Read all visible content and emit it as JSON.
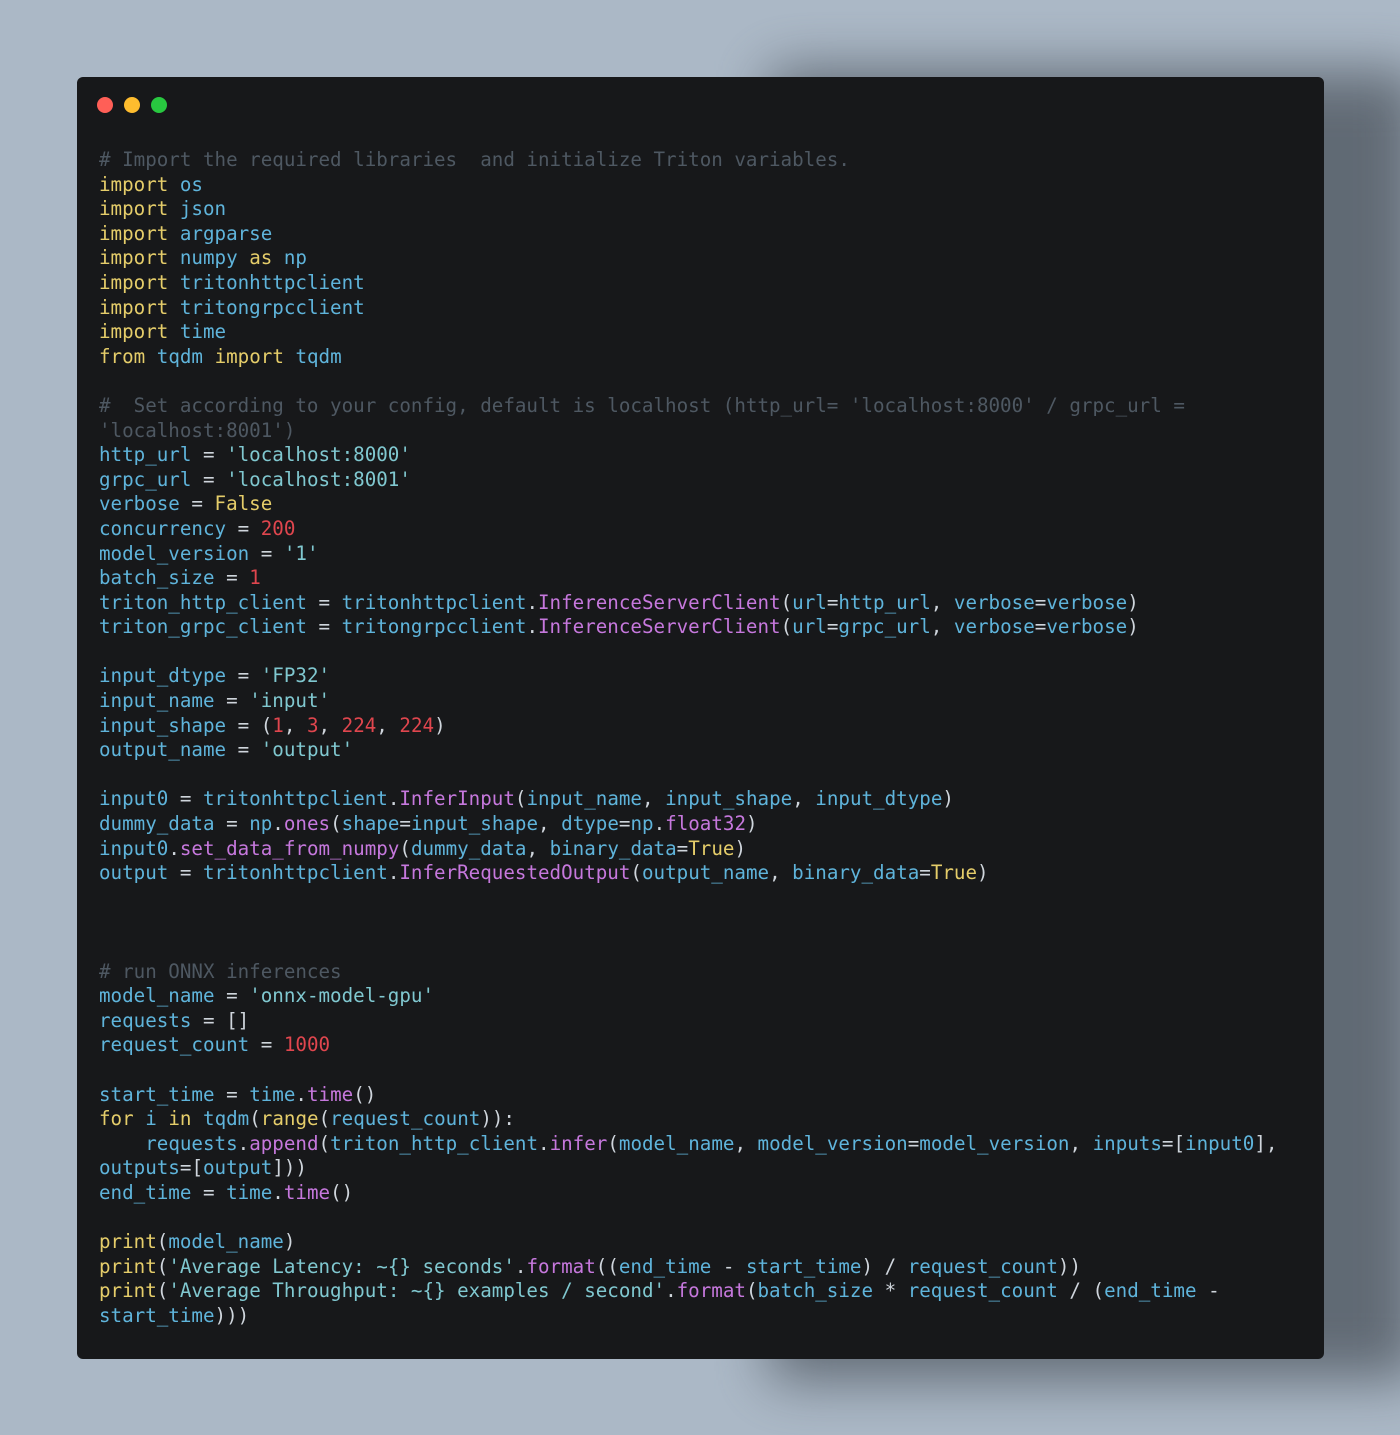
{
  "colors": {
    "background": "#abb8c6",
    "editor_background": "#17181a",
    "close_dot": "#ff5f57",
    "minimize_dot": "#febc2e",
    "maximize_dot": "#28c840",
    "comment": "#4e5862",
    "keyword": "#e5cd6a",
    "identifier": "#5fb4db",
    "string": "#80c8d0",
    "number": "#e0464e",
    "function": "#c678dd",
    "plain": "#cfd5dc"
  },
  "window": {
    "controls": [
      "close",
      "minimize",
      "maximize"
    ]
  },
  "code": {
    "language": "python",
    "lines": [
      [
        [
          "comment",
          "# Import the required libraries  and initialize Triton variables."
        ]
      ],
      [
        [
          "kw",
          "import"
        ],
        [
          "op",
          " "
        ],
        [
          "mod",
          "os"
        ]
      ],
      [
        [
          "kw",
          "import"
        ],
        [
          "op",
          " "
        ],
        [
          "mod",
          "json"
        ]
      ],
      [
        [
          "kw",
          "import"
        ],
        [
          "op",
          " "
        ],
        [
          "mod",
          "argparse"
        ]
      ],
      [
        [
          "kw",
          "import"
        ],
        [
          "op",
          " "
        ],
        [
          "mod",
          "numpy"
        ],
        [
          "op",
          " "
        ],
        [
          "kw",
          "as"
        ],
        [
          "op",
          " "
        ],
        [
          "mod",
          "np"
        ]
      ],
      [
        [
          "kw",
          "import"
        ],
        [
          "op",
          " "
        ],
        [
          "mod",
          "tritonhttpclient"
        ]
      ],
      [
        [
          "kw",
          "import"
        ],
        [
          "op",
          " "
        ],
        [
          "mod",
          "tritongrpcclient"
        ]
      ],
      [
        [
          "kw",
          "import"
        ],
        [
          "op",
          " "
        ],
        [
          "mod",
          "time"
        ]
      ],
      [
        [
          "kw",
          "from"
        ],
        [
          "op",
          " "
        ],
        [
          "mod",
          "tqdm"
        ],
        [
          "op",
          " "
        ],
        [
          "kw",
          "import"
        ],
        [
          "op",
          " "
        ],
        [
          "mod",
          "tqdm"
        ]
      ],
      [],
      [
        [
          "comment",
          "#  Set according to your config, default is localhost (http_url= 'localhost:8000' / grpc_url ="
        ]
      ],
      [
        [
          "comment",
          "'localhost:8001')"
        ]
      ],
      [
        [
          "var",
          "http_url"
        ],
        [
          "op",
          " = "
        ],
        [
          "str",
          "'localhost:8000'"
        ]
      ],
      [
        [
          "var",
          "grpc_url"
        ],
        [
          "op",
          " = "
        ],
        [
          "str",
          "'localhost:8001'"
        ]
      ],
      [
        [
          "var",
          "verbose"
        ],
        [
          "op",
          " = "
        ],
        [
          "const",
          "False"
        ]
      ],
      [
        [
          "var",
          "concurrency"
        ],
        [
          "op",
          " = "
        ],
        [
          "num",
          "200"
        ]
      ],
      [
        [
          "var",
          "model_version"
        ],
        [
          "op",
          " = "
        ],
        [
          "str",
          "'1'"
        ]
      ],
      [
        [
          "var",
          "batch_size"
        ],
        [
          "op",
          " = "
        ],
        [
          "num",
          "1"
        ]
      ],
      [
        [
          "var",
          "triton_http_client"
        ],
        [
          "op",
          " = "
        ],
        [
          "mod",
          "tritonhttpclient"
        ],
        [
          "punc",
          "."
        ],
        [
          "fn",
          "InferenceServerClient"
        ],
        [
          "punc",
          "("
        ],
        [
          "var",
          "url"
        ],
        [
          "op",
          "="
        ],
        [
          "var",
          "http_url"
        ],
        [
          "punc",
          ", "
        ],
        [
          "var",
          "verbose"
        ],
        [
          "op",
          "="
        ],
        [
          "var",
          "verbose"
        ],
        [
          "punc",
          ")"
        ]
      ],
      [
        [
          "var",
          "triton_grpc_client"
        ],
        [
          "op",
          " = "
        ],
        [
          "mod",
          "tritongrpcclient"
        ],
        [
          "punc",
          "."
        ],
        [
          "fn",
          "InferenceServerClient"
        ],
        [
          "punc",
          "("
        ],
        [
          "var",
          "url"
        ],
        [
          "op",
          "="
        ],
        [
          "var",
          "grpc_url"
        ],
        [
          "punc",
          ", "
        ],
        [
          "var",
          "verbose"
        ],
        [
          "op",
          "="
        ],
        [
          "var",
          "verbose"
        ],
        [
          "punc",
          ")"
        ]
      ],
      [],
      [
        [
          "var",
          "input_dtype"
        ],
        [
          "op",
          " = "
        ],
        [
          "str",
          "'FP32'"
        ]
      ],
      [
        [
          "var",
          "input_name"
        ],
        [
          "op",
          " = "
        ],
        [
          "str",
          "'input'"
        ]
      ],
      [
        [
          "var",
          "input_shape"
        ],
        [
          "op",
          " = "
        ],
        [
          "punc",
          "("
        ],
        [
          "num",
          "1"
        ],
        [
          "punc",
          ", "
        ],
        [
          "num",
          "3"
        ],
        [
          "punc",
          ", "
        ],
        [
          "num",
          "224"
        ],
        [
          "punc",
          ", "
        ],
        [
          "num",
          "224"
        ],
        [
          "punc",
          ")"
        ]
      ],
      [
        [
          "var",
          "output_name"
        ],
        [
          "op",
          " = "
        ],
        [
          "str",
          "'output'"
        ]
      ],
      [],
      [
        [
          "var",
          "input0"
        ],
        [
          "op",
          " = "
        ],
        [
          "mod",
          "tritonhttpclient"
        ],
        [
          "punc",
          "."
        ],
        [
          "fn",
          "InferInput"
        ],
        [
          "punc",
          "("
        ],
        [
          "var",
          "input_name"
        ],
        [
          "punc",
          ", "
        ],
        [
          "var",
          "input_shape"
        ],
        [
          "punc",
          ", "
        ],
        [
          "var",
          "input_dtype"
        ],
        [
          "punc",
          ")"
        ]
      ],
      [
        [
          "var",
          "dummy_data"
        ],
        [
          "op",
          " = "
        ],
        [
          "mod",
          "np"
        ],
        [
          "punc",
          "."
        ],
        [
          "fn",
          "ones"
        ],
        [
          "punc",
          "("
        ],
        [
          "var",
          "shape"
        ],
        [
          "op",
          "="
        ],
        [
          "var",
          "input_shape"
        ],
        [
          "punc",
          ", "
        ],
        [
          "var",
          "dtype"
        ],
        [
          "op",
          "="
        ],
        [
          "mod",
          "np"
        ],
        [
          "punc",
          "."
        ],
        [
          "fn",
          "float32"
        ],
        [
          "punc",
          ")"
        ]
      ],
      [
        [
          "var",
          "input0"
        ],
        [
          "punc",
          "."
        ],
        [
          "fn",
          "set_data_from_numpy"
        ],
        [
          "punc",
          "("
        ],
        [
          "var",
          "dummy_data"
        ],
        [
          "punc",
          ", "
        ],
        [
          "var",
          "binary_data"
        ],
        [
          "op",
          "="
        ],
        [
          "const",
          "True"
        ],
        [
          "punc",
          ")"
        ]
      ],
      [
        [
          "var",
          "output"
        ],
        [
          "op",
          " = "
        ],
        [
          "mod",
          "tritonhttpclient"
        ],
        [
          "punc",
          "."
        ],
        [
          "fn",
          "InferRequestedOutput"
        ],
        [
          "punc",
          "("
        ],
        [
          "var",
          "output_name"
        ],
        [
          "punc",
          ", "
        ],
        [
          "var",
          "binary_data"
        ],
        [
          "op",
          "="
        ],
        [
          "const",
          "True"
        ],
        [
          "punc",
          ")"
        ]
      ],
      [],
      [],
      [],
      [
        [
          "comment",
          "# run ONNX inferences"
        ]
      ],
      [
        [
          "var",
          "model_name"
        ],
        [
          "op",
          " = "
        ],
        [
          "str",
          "'onnx-model-gpu'"
        ]
      ],
      [
        [
          "var",
          "requests"
        ],
        [
          "op",
          " = "
        ],
        [
          "punc",
          "[]"
        ]
      ],
      [
        [
          "var",
          "request_count"
        ],
        [
          "op",
          " = "
        ],
        [
          "num",
          "1000"
        ]
      ],
      [],
      [
        [
          "var",
          "start_time"
        ],
        [
          "op",
          " = "
        ],
        [
          "mod",
          "time"
        ],
        [
          "punc",
          "."
        ],
        [
          "fn",
          "time"
        ],
        [
          "punc",
          "()"
        ]
      ],
      [
        [
          "kw",
          "for"
        ],
        [
          "op",
          " "
        ],
        [
          "var",
          "i"
        ],
        [
          "op",
          " "
        ],
        [
          "kw",
          "in"
        ],
        [
          "op",
          " "
        ],
        [
          "var",
          "tqdm"
        ],
        [
          "punc",
          "("
        ],
        [
          "builtin",
          "range"
        ],
        [
          "punc",
          "("
        ],
        [
          "var",
          "request_count"
        ],
        [
          "punc",
          ")):"
        ]
      ],
      [
        [
          "op",
          "    "
        ],
        [
          "var",
          "requests"
        ],
        [
          "punc",
          "."
        ],
        [
          "fn",
          "append"
        ],
        [
          "punc",
          "("
        ],
        [
          "var",
          "triton_http_client"
        ],
        [
          "punc",
          "."
        ],
        [
          "fn",
          "infer"
        ],
        [
          "punc",
          "("
        ],
        [
          "var",
          "model_name"
        ],
        [
          "punc",
          ", "
        ],
        [
          "var",
          "model_version"
        ],
        [
          "op",
          "="
        ],
        [
          "var",
          "model_version"
        ],
        [
          "punc",
          ", "
        ],
        [
          "var",
          "inputs"
        ],
        [
          "op",
          "="
        ],
        [
          "punc",
          "["
        ],
        [
          "var",
          "input0"
        ],
        [
          "punc",
          "],"
        ]
      ],
      [
        [
          "var",
          "outputs"
        ],
        [
          "op",
          "="
        ],
        [
          "punc",
          "["
        ],
        [
          "var",
          "output"
        ],
        [
          "punc",
          "]))"
        ]
      ],
      [
        [
          "var",
          "end_time"
        ],
        [
          "op",
          " = "
        ],
        [
          "mod",
          "time"
        ],
        [
          "punc",
          "."
        ],
        [
          "fn",
          "time"
        ],
        [
          "punc",
          "()"
        ]
      ],
      [],
      [
        [
          "builtin",
          "print"
        ],
        [
          "punc",
          "("
        ],
        [
          "var",
          "model_name"
        ],
        [
          "punc",
          ")"
        ]
      ],
      [
        [
          "builtin",
          "print"
        ],
        [
          "punc",
          "("
        ],
        [
          "str",
          "'Average Latency: ~{} seconds'"
        ],
        [
          "punc",
          "."
        ],
        [
          "fn",
          "format"
        ],
        [
          "punc",
          "(("
        ],
        [
          "var",
          "end_time"
        ],
        [
          "op",
          " - "
        ],
        [
          "var",
          "start_time"
        ],
        [
          "punc",
          ") "
        ],
        [
          "op",
          "/ "
        ],
        [
          "var",
          "request_count"
        ],
        [
          "punc",
          "))"
        ]
      ],
      [
        [
          "builtin",
          "print"
        ],
        [
          "punc",
          "("
        ],
        [
          "str",
          "'Average Throughput: ~{} examples / second'"
        ],
        [
          "punc",
          "."
        ],
        [
          "fn",
          "format"
        ],
        [
          "punc",
          "("
        ],
        [
          "var",
          "batch_size"
        ],
        [
          "op",
          " * "
        ],
        [
          "var",
          "request_count"
        ],
        [
          "op",
          " / "
        ],
        [
          "punc",
          "("
        ],
        [
          "var",
          "end_time"
        ],
        [
          "op",
          " -"
        ]
      ],
      [
        [
          "var",
          "start_time"
        ],
        [
          "punc",
          ")))"
        ]
      ]
    ]
  }
}
